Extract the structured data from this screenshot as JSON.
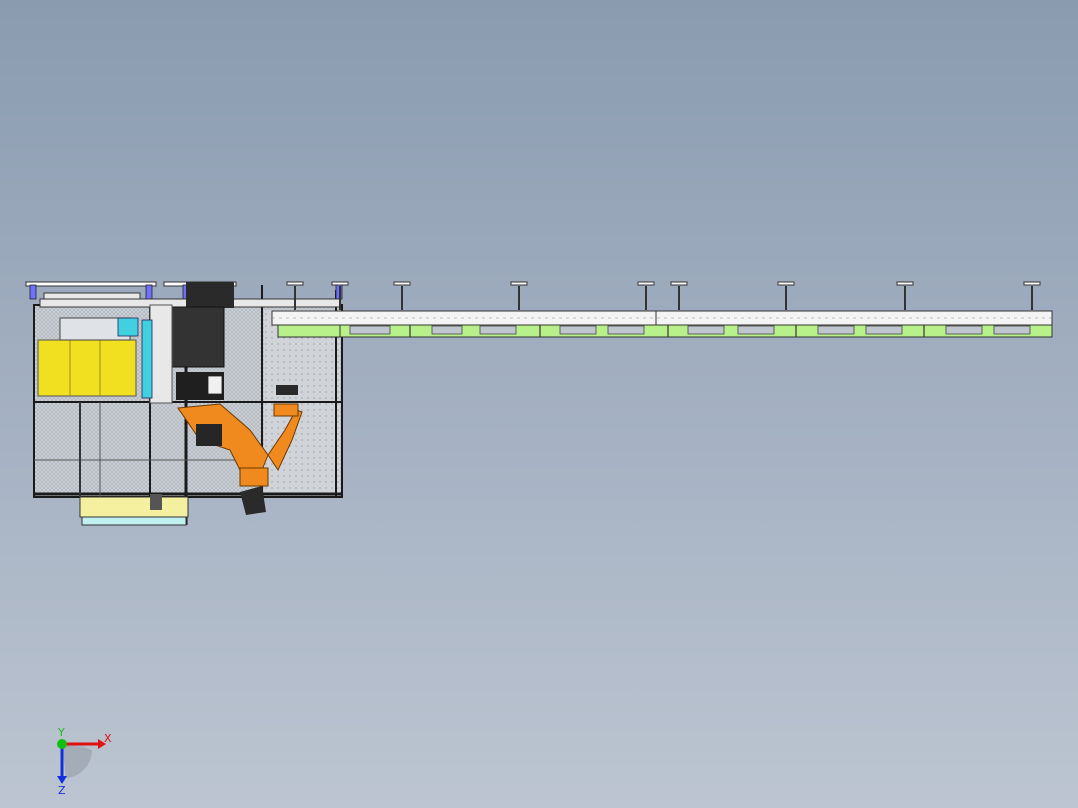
{
  "viewport": {
    "background_top": "#8a9bb0",
    "background_bottom": "#bcc5d1"
  },
  "triad": {
    "x_label": "X",
    "y_label": "Y",
    "z_label": "Z",
    "x_color": "#e01010",
    "y_color": "#10c010",
    "z_color": "#1030e0"
  },
  "colors": {
    "robot": "#f08a1e",
    "guard": "#f0e020",
    "conveyor": "#b8f08a",
    "frame": "#1a1a1a",
    "accent_cyan": "#40d0e0"
  }
}
